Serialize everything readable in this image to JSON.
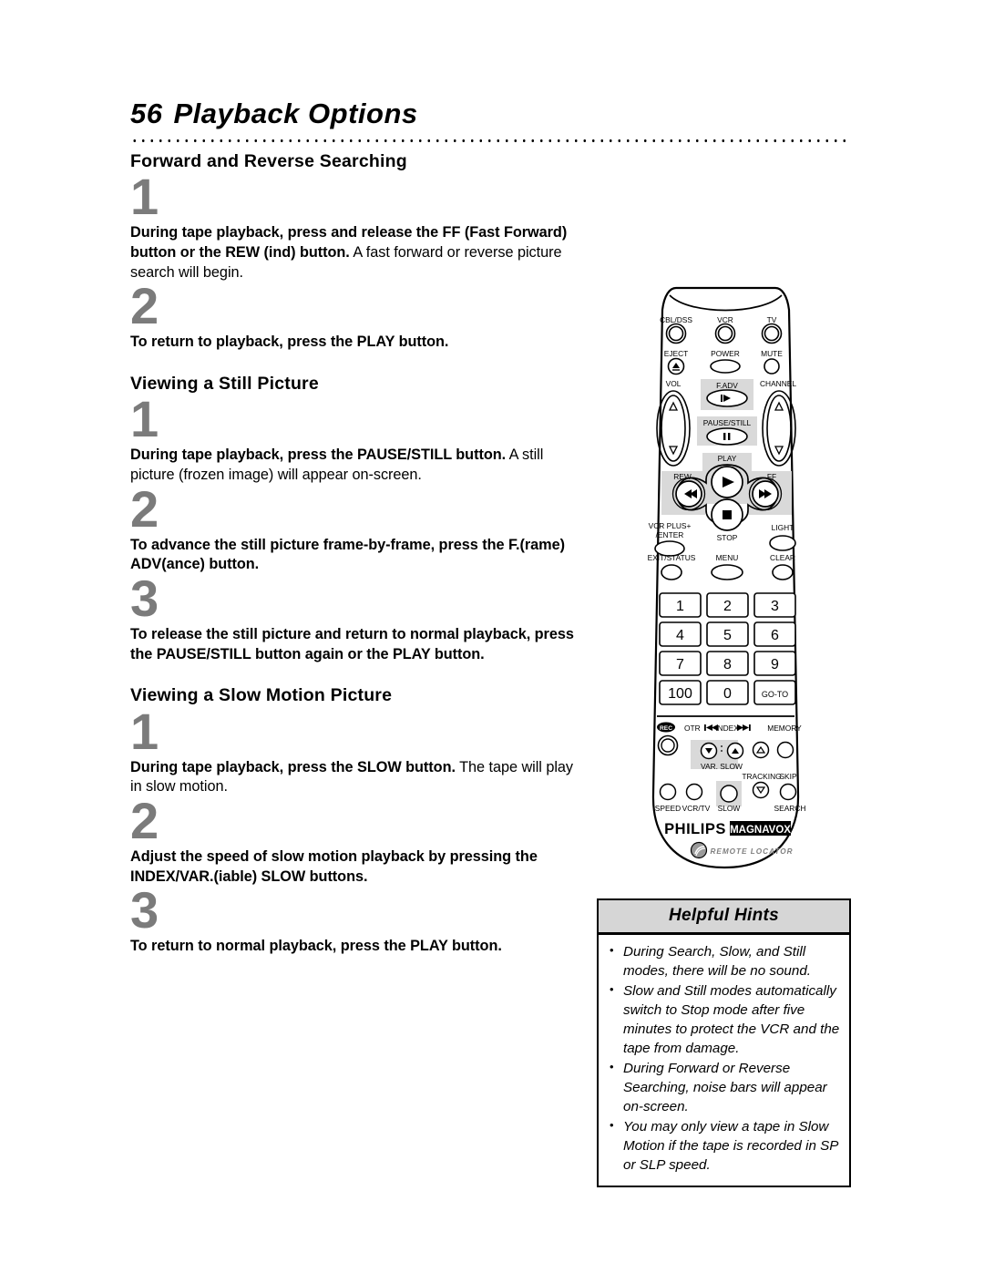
{
  "page": {
    "number": "56",
    "title": "Playback Options"
  },
  "sections": [
    {
      "heading": "Forward and Reverse Searching",
      "steps": [
        {
          "number": "1",
          "bold": "During tape playback, press and release the FF (Fast Forward) button or the REW (ind) button.",
          "normal": " A fast forward or reverse picture search will begin."
        },
        {
          "number": "2",
          "bold": "To return to playback, press the PLAY button.",
          "normal": ""
        }
      ]
    },
    {
      "heading": "Viewing a Still Picture",
      "steps": [
        {
          "number": "1",
          "bold": "During tape playback, press the PAUSE/STILL button.",
          "normal": "  A still picture (frozen image) will appear on-screen."
        },
        {
          "number": "2",
          "bold": "To advance the still picture frame-by-frame, press the F.(rame) ADV(ance) button.",
          "normal": ""
        },
        {
          "number": "3",
          "bold": "To release the still picture and return to normal playback, press the PAUSE/STILL button again or the PLAY button.",
          "normal": ""
        }
      ]
    },
    {
      "heading": "Viewing a Slow Motion Picture",
      "steps": [
        {
          "number": "1",
          "bold": "During tape playback, press the SLOW button.",
          "normal": " The tape will play in slow motion."
        },
        {
          "number": "2",
          "bold": "Adjust the speed of slow motion playback by pressing the INDEX/VAR.(iable) SLOW buttons.",
          "normal": ""
        },
        {
          "number": "3",
          "bold": "To return to normal playback, press the PLAY button.",
          "normal": ""
        }
      ]
    }
  ],
  "hints": {
    "title": "Helpful Hints",
    "items": [
      "During Search, Slow, and Still modes, there will be no sound.",
      "Slow and Still modes automatically switch to Stop mode after five minutes to protect the VCR and the tape from damage.",
      "During Forward or Reverse Searching, noise bars will appear on-screen.",
      "You may only view a tape in Slow Motion if the tape is recorded in SP or SLP speed."
    ]
  },
  "remote": {
    "brand": "PHILIPS",
    "brand2": "MAGNAVOX",
    "locator": "REMOTE LOCATOR",
    "labels": {
      "cbl_dss": "CBL/DSS",
      "vcr": "VCR",
      "tv": "TV",
      "eject": "EJECT",
      "power": "POWER",
      "mute": "MUTE",
      "vol": "VOL",
      "f_adv": "F.ADV",
      "channel": "CHANNEL",
      "pause_still": "PAUSE/STILL",
      "play": "PLAY",
      "rew": "REW",
      "ff": "FF",
      "stop": "STOP",
      "vcr_plus": "VCR PLUS+",
      "enter": "/ENTER",
      "light": "LIGHT",
      "exit_status": "EXIT/STATUS",
      "menu": "MENU",
      "clear": "CLEAR",
      "rec": "REC",
      "otr": "OTR",
      "index": "INDEX",
      "memory": "MEMORY",
      "var_slow": "VAR. SLOW",
      "tracking": "TRACKING",
      "skip": "SKIP",
      "speed": "SPEED",
      "vcr_tv": "VCR/TV",
      "slow": "SLOW",
      "search": "SEARCH"
    },
    "keypad": [
      [
        "1",
        "2",
        "3"
      ],
      [
        "4",
        "5",
        "6"
      ],
      [
        "7",
        "8",
        "9"
      ],
      [
        "100",
        "0",
        "GO-TO"
      ]
    ]
  },
  "colors": {
    "step_number_gray": "#7b7b7b",
    "hint_header_gray": "#d6d6d6",
    "remote_highlight_gray": "#d9d9d9",
    "ink": "#000000",
    "paper": "#ffffff"
  }
}
